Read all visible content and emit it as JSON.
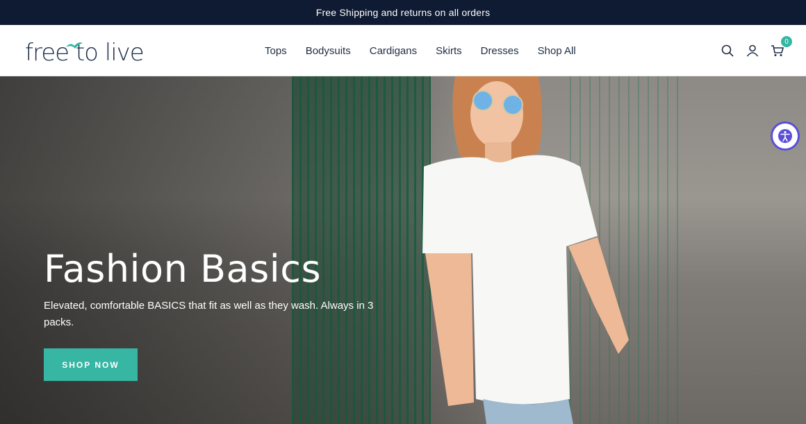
{
  "announcement": "Free Shipping and returns on all orders",
  "logo": {
    "text": "free to live"
  },
  "nav": {
    "items": [
      {
        "label": "Tops"
      },
      {
        "label": "Bodysuits"
      },
      {
        "label": "Cardigans"
      },
      {
        "label": "Skirts"
      },
      {
        "label": "Dresses"
      },
      {
        "label": "Shop All"
      }
    ]
  },
  "header_icons": {
    "search": "search-icon",
    "account": "user-icon",
    "cart": "cart-icon",
    "cart_count": "0"
  },
  "hero": {
    "title": "Fashion Basics",
    "subtitle": "Elevated, comfortable BASICS that fit as well as they wash. Always in 3 packs.",
    "cta_label": "SHOP NOW"
  },
  "colors": {
    "announcement_bg": "#0f1a33",
    "accent": "#36b6a3",
    "accessibility": "#5b4ed8"
  }
}
